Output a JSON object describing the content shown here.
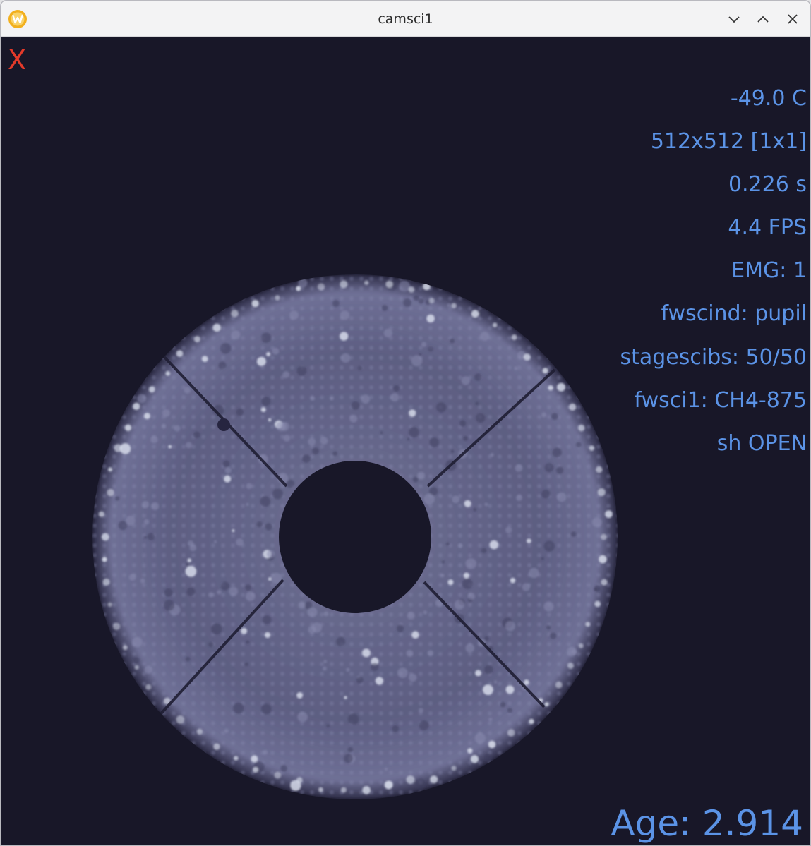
{
  "window": {
    "title": "camsci1",
    "app_icon": "w-logo-icon",
    "controls": [
      "minimize-chevron-icon",
      "maximize-chevron-icon",
      "close-icon"
    ]
  },
  "overlay": {
    "close_label": "X",
    "close_color": "#e33a2a",
    "text_color": "#5b93e6",
    "stats": [
      "-49.0 C",
      "512x512 [1x1]",
      "0.226 s",
      "4.4 FPS",
      "EMG: 1",
      "fwscind: pupil",
      "stagescibs: 50/50",
      "fwsci1: CH4-875",
      "sh OPEN"
    ],
    "age": "Age: 2.914"
  },
  "image": {
    "content": "camera-pupil-image",
    "background_color": "#181728",
    "pupil_color": "#8e8fb3"
  }
}
